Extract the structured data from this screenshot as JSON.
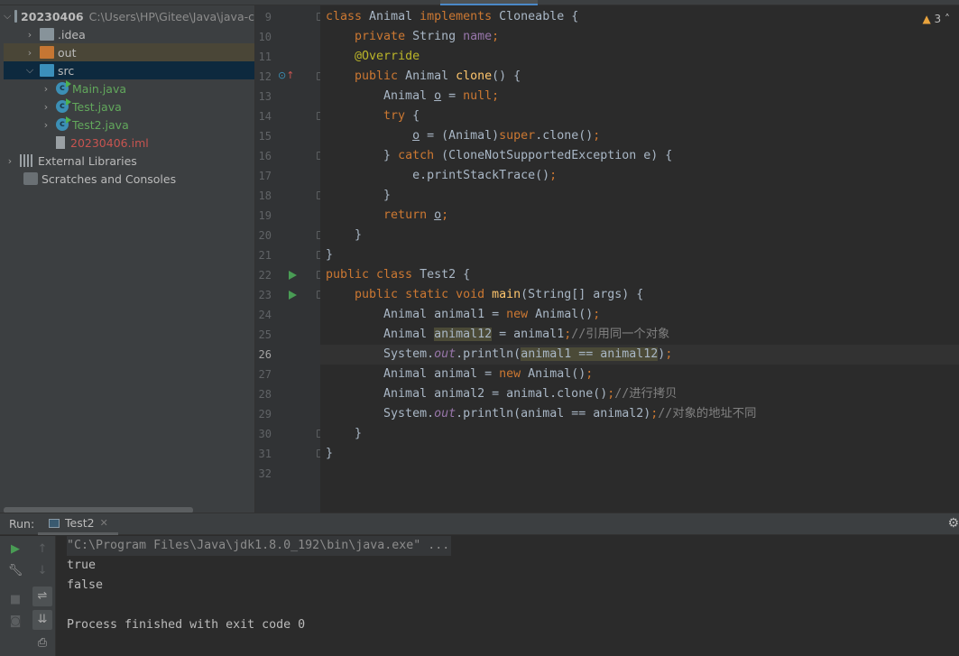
{
  "project": {
    "root": {
      "name": "20230406",
      "path": "C:\\Users\\HP\\Gitee\\Java\\java-c"
    },
    "items": [
      {
        "label": ".idea",
        "type": "folder"
      },
      {
        "label": "out",
        "type": "folder-excluded"
      },
      {
        "label": "src",
        "type": "folder-source",
        "expanded": true,
        "selected": true
      },
      {
        "label": "Main.java",
        "type": "java-class"
      },
      {
        "label": "Test.java",
        "type": "java-class"
      },
      {
        "label": "Test2.java",
        "type": "java-class"
      },
      {
        "label": "20230406.iml",
        "type": "iml-file"
      },
      {
        "label": "External Libraries",
        "type": "libraries"
      },
      {
        "label": "Scratches and Consoles",
        "type": "scratches"
      }
    ]
  },
  "editor": {
    "warnings": "3",
    "current_line": 26,
    "lines": [
      {
        "n": 9,
        "tokens": [
          [
            "kw",
            "class "
          ],
          [
            "",
            "Animal "
          ],
          [
            "kw",
            "implements "
          ],
          [
            "",
            "Cloneable {"
          ]
        ]
      },
      {
        "n": 10,
        "tokens": [
          [
            "",
            "    "
          ],
          [
            "kw",
            "private "
          ],
          [
            "",
            "String "
          ],
          [
            "fld",
            "name"
          ],
          [
            "kw",
            ";"
          ]
        ]
      },
      {
        "n": 11,
        "tokens": [
          [
            "",
            "    "
          ],
          [
            "an",
            "@Override"
          ]
        ]
      },
      {
        "n": 12,
        "tokens": [
          [
            "",
            "    "
          ],
          [
            "kw",
            "public "
          ],
          [
            "",
            "Animal "
          ],
          [
            "fn",
            "clone"
          ],
          [
            "",
            "() {"
          ]
        ]
      },
      {
        "n": 13,
        "tokens": [
          [
            "",
            "        Animal "
          ],
          [
            "ul",
            "o"
          ],
          [
            "",
            " = "
          ],
          [
            "kw",
            "null;"
          ]
        ]
      },
      {
        "n": 14,
        "tokens": [
          [
            "",
            "        "
          ],
          [
            "kw",
            "try "
          ],
          [
            "",
            "{"
          ]
        ]
      },
      {
        "n": 15,
        "tokens": [
          [
            "",
            "            "
          ],
          [
            "ul",
            "o"
          ],
          [
            "",
            " = (Animal)"
          ],
          [
            "kw",
            "super"
          ],
          [
            "",
            ".clone()"
          ],
          [
            "kw",
            ";"
          ]
        ]
      },
      {
        "n": 16,
        "tokens": [
          [
            "",
            "        } "
          ],
          [
            "kw",
            "catch "
          ],
          [
            "",
            "(CloneNotSupportedException e) {"
          ]
        ]
      },
      {
        "n": 17,
        "tokens": [
          [
            "",
            "            e.printStackTrace()"
          ],
          [
            "kw",
            ";"
          ]
        ]
      },
      {
        "n": 18,
        "tokens": [
          [
            "",
            "        }"
          ]
        ]
      },
      {
        "n": 19,
        "tokens": [
          [
            "",
            "        "
          ],
          [
            "kw",
            "return "
          ],
          [
            "ul",
            "o"
          ],
          [
            "kw",
            ";"
          ]
        ]
      },
      {
        "n": 20,
        "tokens": [
          [
            "",
            "    }"
          ]
        ]
      },
      {
        "n": 21,
        "tokens": [
          [
            "",
            "}"
          ]
        ]
      },
      {
        "n": 22,
        "tokens": [
          [
            "kw",
            "public class "
          ],
          [
            "",
            "Test2 {"
          ]
        ]
      },
      {
        "n": 23,
        "tokens": [
          [
            "",
            "    "
          ],
          [
            "kw",
            "public static void "
          ],
          [
            "fn",
            "main"
          ],
          [
            "",
            "(String[] args) {"
          ]
        ]
      },
      {
        "n": 24,
        "tokens": [
          [
            "",
            "        Animal animal1 = "
          ],
          [
            "kw",
            "new "
          ],
          [
            "",
            "Animal()"
          ],
          [
            "kw",
            ";"
          ]
        ]
      },
      {
        "n": 25,
        "tokens": [
          [
            "",
            "        Animal "
          ],
          [
            "hl",
            "animal12"
          ],
          [
            "",
            " = animal1"
          ],
          [
            "kw",
            ";"
          ],
          [
            "cm",
            "//引用同一个对象"
          ]
        ]
      },
      {
        "n": 26,
        "tokens": [
          [
            "",
            "        System."
          ],
          [
            "st",
            "out"
          ],
          [
            "",
            ".println("
          ],
          [
            "hl",
            "animal1 == animal12"
          ],
          [
            "",
            ")"
          ],
          [
            "kw",
            ";"
          ]
        ]
      },
      {
        "n": 27,
        "tokens": [
          [
            "",
            "        Animal animal = "
          ],
          [
            "kw",
            "new "
          ],
          [
            "",
            "Animal()"
          ],
          [
            "kw",
            ";"
          ]
        ]
      },
      {
        "n": 28,
        "tokens": [
          [
            "",
            "        Animal animal2 = animal.clone()"
          ],
          [
            "kw",
            ";"
          ],
          [
            "cm",
            "//进行拷贝"
          ]
        ]
      },
      {
        "n": 29,
        "tokens": [
          [
            "",
            "        System."
          ],
          [
            "st",
            "out"
          ],
          [
            "",
            ".println(animal == animal2)"
          ],
          [
            "kw",
            ";"
          ],
          [
            "cm",
            "//对象的地址不同"
          ]
        ]
      },
      {
        "n": 30,
        "tokens": [
          [
            "",
            "    }"
          ]
        ]
      },
      {
        "n": 31,
        "tokens": [
          [
            "",
            "}"
          ]
        ]
      },
      {
        "n": 32,
        "tokens": []
      }
    ]
  },
  "run": {
    "label": "Run:",
    "tab": "Test2",
    "output": [
      "\"C:\\Program Files\\Java\\jdk1.8.0_192\\bin\\java.exe\" ...",
      "true",
      "false",
      "",
      "Process finished with exit code 0"
    ]
  },
  "colors": {
    "keyword": "#cc7832",
    "method": "#ffc66d",
    "field": "#9876aa",
    "annotation": "#bbb529",
    "comment": "#808080",
    "text": "#a9b7c6",
    "selection": "#0d293e",
    "run": "#499c54"
  }
}
